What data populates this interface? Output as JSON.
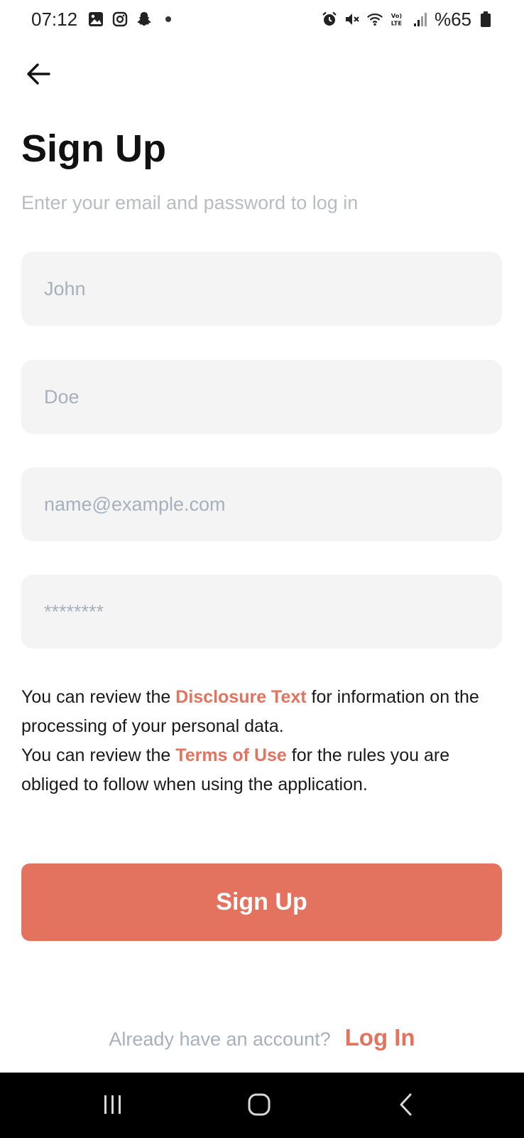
{
  "status_bar": {
    "time": "07:12",
    "battery": "%65",
    "left_icons": [
      "gallery-icon",
      "instagram-icon",
      "snapchat-icon",
      "notification-dot"
    ],
    "right_icons": [
      "alarm-icon",
      "mute-icon",
      "wifi-icon",
      "volte-icon",
      "signal-icon",
      "battery-icon"
    ]
  },
  "header": {
    "back_icon": "arrow-left-icon",
    "title": "Sign Up",
    "subtitle": "Enter your email and password to log in"
  },
  "form": {
    "first_name": {
      "value": "",
      "placeholder": "John"
    },
    "last_name": {
      "value": "",
      "placeholder": "Doe"
    },
    "email": {
      "value": "",
      "placeholder": "name@example.com"
    },
    "password": {
      "value": "",
      "placeholder": "********"
    }
  },
  "disclosure": {
    "line1_prefix": "You can review the ",
    "line1_link": "Disclosure Text",
    "line1_suffix": " for information on the processing of your personal data.",
    "line2_prefix": "You can review the ",
    "line2_link": "Terms of Use",
    "line2_suffix": " for the rules you are obliged to follow when using the application."
  },
  "actions": {
    "signup_label": "Sign Up"
  },
  "footer": {
    "prompt": "Already have an account?",
    "login_label": "Log In"
  },
  "nav_bar": {
    "icons": [
      "recents-icon",
      "home-icon",
      "back-icon"
    ]
  },
  "colors": {
    "accent": "#e3725e",
    "field_bg": "#f4f4f4",
    "placeholder": "#a6b1bd",
    "subtitle": "#b8bcc2"
  }
}
